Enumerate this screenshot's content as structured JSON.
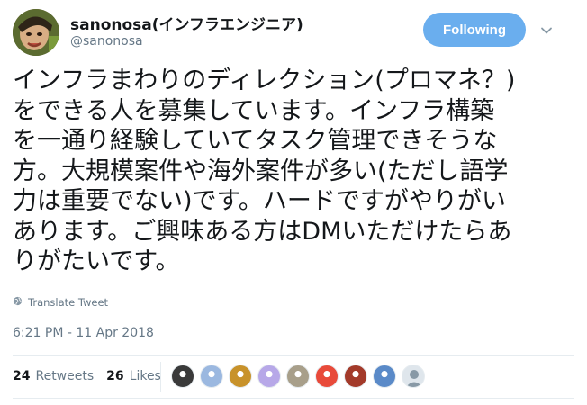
{
  "author": {
    "display_name": "sanonosa(インフラエンジニア)",
    "handle": "@sanonosa"
  },
  "follow_button": {
    "label": "Following"
  },
  "tweet": {
    "text": "インフラまわりのディレクション(プロマネ？)\nをできる人を募集しています。インフラ構築\nを一通り経験していてタスク管理できそうな\n方。大規模案件や海外案件が多い(ただし語学\n力は重要でない)です。ハードですがやりがい\nあります。ご興味ある方はDMいただけたらあ\nりがたいです。",
    "translate_label": "Translate Tweet",
    "timestamp": "6:21 PM - 11 Apr 2018"
  },
  "stats": {
    "retweets_count": "24",
    "retweets_label": "Retweets",
    "likes_count": "26",
    "likes_label": "Likes"
  },
  "likers": [
    {
      "name": "liker-1",
      "color": "#3a3a3a"
    },
    {
      "name": "liker-2",
      "color": "#9bb8e0"
    },
    {
      "name": "liker-3",
      "color": "#c8922a"
    },
    {
      "name": "liker-4",
      "color": "#b7a8e8"
    },
    {
      "name": "liker-5",
      "color": "#a89f8a"
    },
    {
      "name": "liker-6",
      "color": "#e84a3a"
    },
    {
      "name": "liker-7",
      "color": "#a33a2a"
    },
    {
      "name": "liker-8",
      "color": "#5a8ac8"
    },
    {
      "name": "liker-9",
      "color": "#aab8c2"
    }
  ],
  "colors": {
    "accent": "#6aaeee",
    "secondary_text": "#657786",
    "primary_text": "#14171a"
  },
  "icons": {
    "caret": "chevron-down-icon",
    "translate": "globe-icon"
  }
}
